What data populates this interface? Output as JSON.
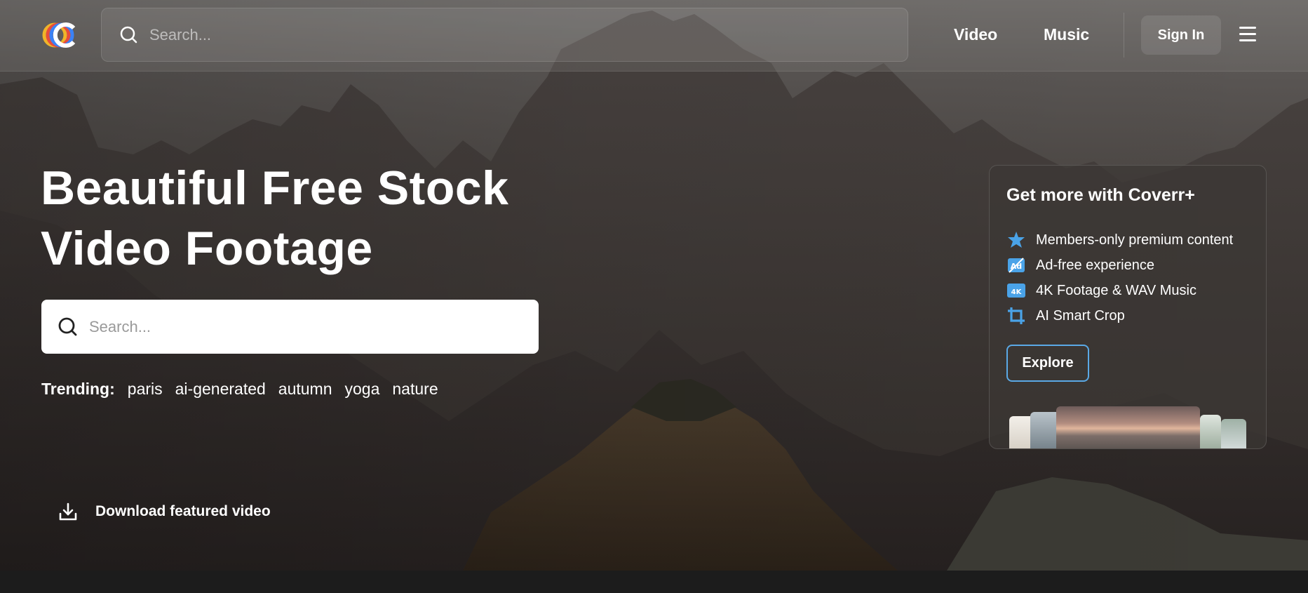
{
  "header": {
    "search_placeholder": "Search...",
    "nav": [
      {
        "label": "Video"
      },
      {
        "label": "Music"
      }
    ],
    "signin_label": "Sign In"
  },
  "hero": {
    "title_line1": "Beautiful Free Stock",
    "title_line2": "Video Footage",
    "search_placeholder": "Search...",
    "trending_label": "Trending:",
    "trending_tags": [
      "paris",
      "ai-generated",
      "autumn",
      "yoga",
      "nature"
    ],
    "download_label": "Download featured video"
  },
  "promo": {
    "title": "Get more with Coverr+",
    "features": [
      {
        "icon": "star-icon",
        "label": "Members-only premium content"
      },
      {
        "icon": "ad-free-icon",
        "label": "Ad-free experience"
      },
      {
        "icon": "4k-icon",
        "label": "4K Footage & WAV Music",
        "badge": "4K"
      },
      {
        "icon": "crop-icon",
        "label": "AI Smart Crop"
      }
    ],
    "explore_label": "Explore"
  },
  "colors": {
    "accent_blue": "#5aa9e6",
    "icon_blue": "#4aa3e8"
  }
}
